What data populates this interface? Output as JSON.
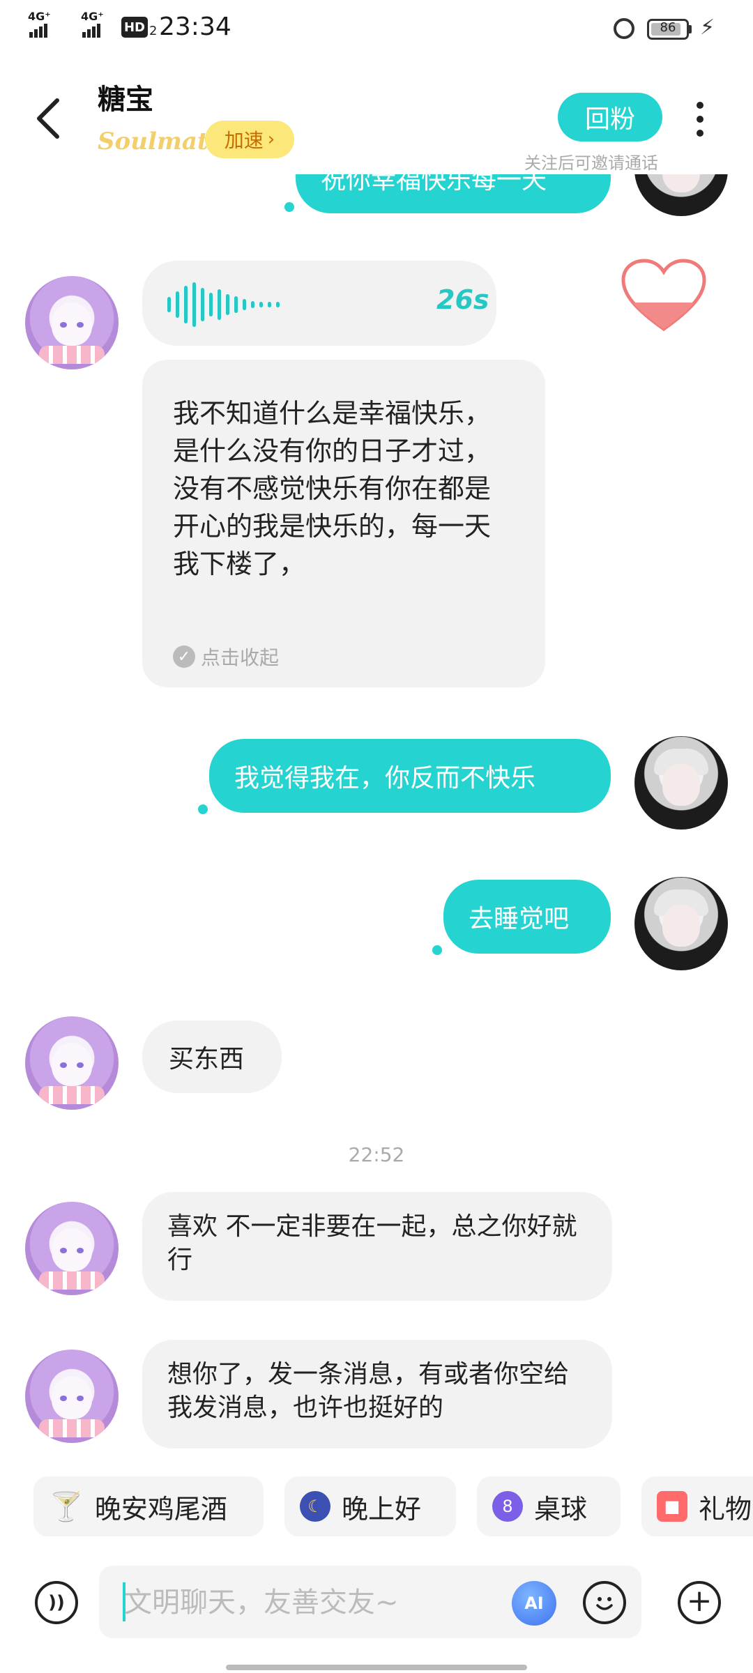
{
  "status_bar": {
    "network1": "4G⁺",
    "network2": "4G⁺",
    "hd": "HD",
    "sim": "2",
    "time": "23:34",
    "battery": "86"
  },
  "header": {
    "contact_name": "糖宝",
    "soulmate_label": "Soulmate",
    "speed_up_label": "加速",
    "follow_back_label": "回粉",
    "follow_hint": "关注后可邀请通话"
  },
  "messages": {
    "top_partial": "祝你幸福快乐每一天",
    "voice_duration": "26s",
    "voice_transcript": "我不知道什么是幸福快乐，是什么没有你的日子才过，没有不感觉快乐有你在都是开心的我是快乐的，每一天我下楼了，",
    "collapse_label": "点击收起",
    "out_1": "我觉得我在，你反而不快乐",
    "out_2": "去睡觉吧",
    "in_1": "买东西",
    "timestamp": "22:52",
    "in_2": "喜欢 不一定非要在一起，总之你好就行",
    "in_3": "想你了，发一条消息，有或者你空给我发消息，也许也挺好的"
  },
  "quick_chips": [
    {
      "label": "晚安鸡尾酒",
      "icon": "cocktail-icon"
    },
    {
      "label": "晚上好",
      "icon": "moon-icon"
    },
    {
      "label": "桌球",
      "icon": "billiard-icon"
    },
    {
      "label": "礼物",
      "icon": "gift-icon"
    }
  ],
  "input": {
    "placeholder": "文明聊天，友善交友~",
    "ai_label": "AI"
  },
  "colors": {
    "accent": "#25d4d0",
    "speed_bg": "#fce77b",
    "bubble_in": "#f2f2f2"
  }
}
